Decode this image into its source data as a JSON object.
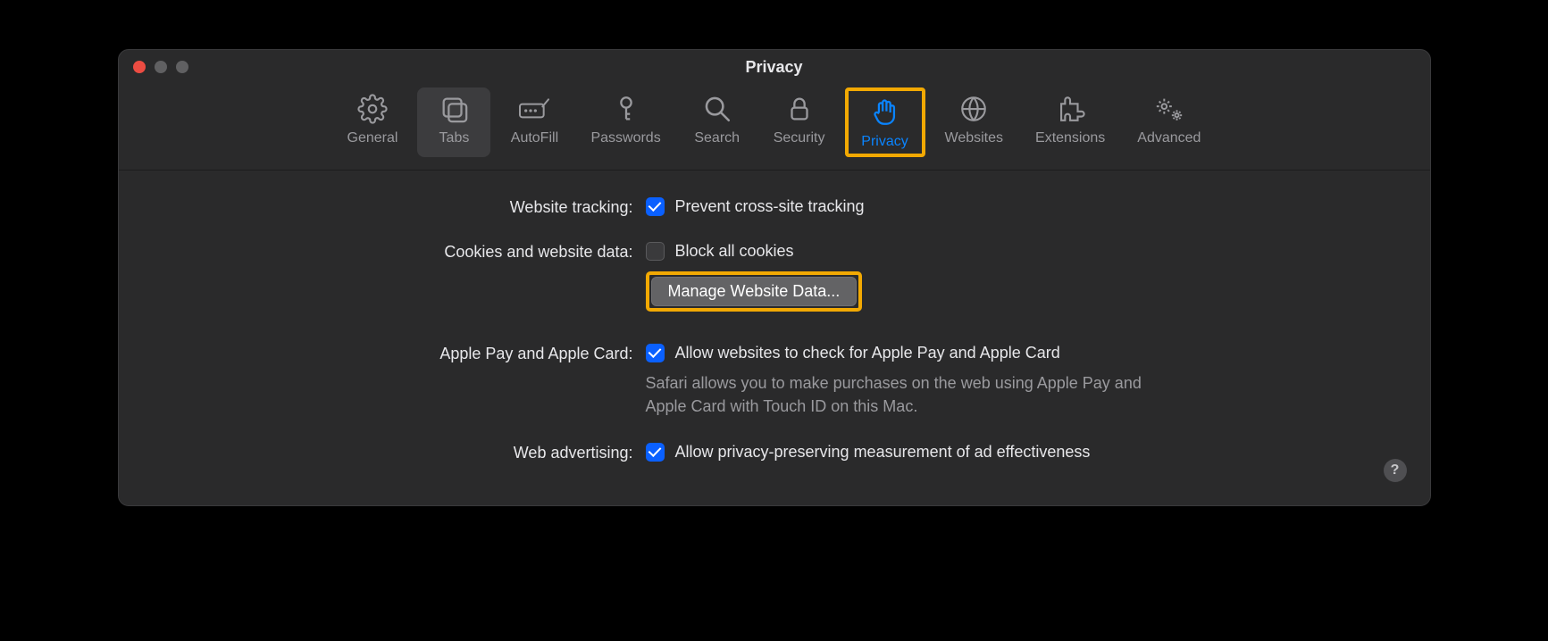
{
  "window": {
    "title": "Privacy"
  },
  "toolbar": {
    "items": [
      {
        "id": "general",
        "label": "General"
      },
      {
        "id": "tabs",
        "label": "Tabs"
      },
      {
        "id": "autofill",
        "label": "AutoFill"
      },
      {
        "id": "passwords",
        "label": "Passwords"
      },
      {
        "id": "search",
        "label": "Search"
      },
      {
        "id": "security",
        "label": "Security"
      },
      {
        "id": "privacy",
        "label": "Privacy"
      },
      {
        "id": "websites",
        "label": "Websites"
      },
      {
        "id": "extensions",
        "label": "Extensions"
      },
      {
        "id": "advanced",
        "label": "Advanced"
      }
    ]
  },
  "settings": {
    "tracking": {
      "label": "Website tracking:",
      "checkbox_label": "Prevent cross-site tracking",
      "checked": true
    },
    "cookies": {
      "label": "Cookies and website data:",
      "checkbox_label": "Block all cookies",
      "checked": false,
      "button_label": "Manage Website Data..."
    },
    "applepay": {
      "label": "Apple Pay and Apple Card:",
      "checkbox_label": "Allow websites to check for Apple Pay and Apple Card",
      "checked": true,
      "description": "Safari allows you to make purchases on the web using Apple Pay and Apple Card with Touch ID on this Mac."
    },
    "ads": {
      "label": "Web advertising:",
      "checkbox_label": "Allow privacy-preserving measurement of ad effectiveness",
      "checked": true
    }
  },
  "help_button": "?"
}
